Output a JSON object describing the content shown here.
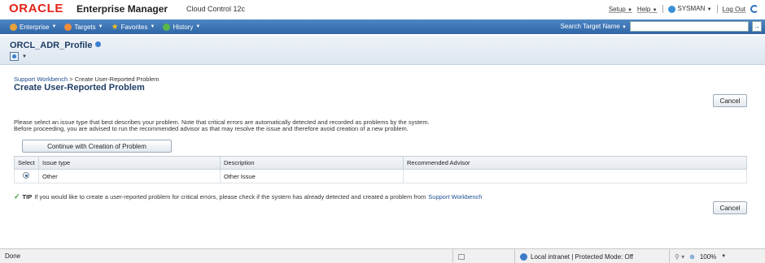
{
  "header": {
    "brand": "ORACLE",
    "product": "Enterprise Manager",
    "edition": "Cloud Control 12c",
    "global_links": {
      "setup": "Setup",
      "help": "Help",
      "user": "SYSMAN",
      "logout": "Log Out"
    }
  },
  "menubar": {
    "items": [
      {
        "label": "Enterprise",
        "icon": "enterprise-icon",
        "color": "#e6a23c"
      },
      {
        "label": "Targets",
        "icon": "targets-icon",
        "color": "#f08c3a"
      },
      {
        "label": "Favorites",
        "icon": "star-icon",
        "color": "#f2c21b"
      },
      {
        "label": "History",
        "icon": "history-icon",
        "color": "#58b848"
      }
    ],
    "search_label": "Search Target Name",
    "search_value": "",
    "search_go": "→"
  },
  "target": {
    "name": "ORCL_ADR_Profile"
  },
  "page": {
    "breadcrumb_root": "Support Workbench",
    "breadcrumb_separator": ">",
    "breadcrumb_current": "Create User-Reported Problem",
    "title": "Create User-Reported Problem",
    "cancel": "Cancel",
    "description_line1": "Please select an issue type that best describes your problem. Note that critical errors are automatically detected and recorded as problems by the system.",
    "description_line2": "Before proceeding, you are advised to run the recommended advisor as that may resolve the issue and therefore avoid creation of a new problem.",
    "continue_button": "Continue with Creation of Problem",
    "table": {
      "columns": [
        "Select",
        "Issue type",
        "Description",
        "Recommended Advisor"
      ],
      "rows": [
        {
          "selected": true,
          "issue_type": "Other",
          "description": "Other Issue",
          "advisor": ""
        }
      ]
    },
    "tip": {
      "label": "TIP",
      "text": "If you would like to create a user-reported problem for critical errors, please check if the system has already detected and created a problem from",
      "link": "Support Workbench"
    }
  },
  "statusbar": {
    "status": "Done",
    "zone": "Local intranet | Protected Mode: Off",
    "zoom": "100%"
  }
}
